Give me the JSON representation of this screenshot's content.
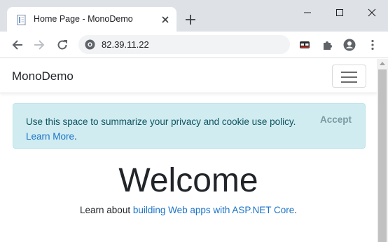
{
  "browser": {
    "tab": {
      "title": "Home Page - MonoDemo"
    },
    "address": {
      "url": "82.39.11.22"
    },
    "colors": {
      "tabstrip": "#dee1e6",
      "omnibox": "#f1f3f4"
    }
  },
  "page": {
    "brand": "MonoDemo",
    "cookie": {
      "text": "Use this space to summarize your privacy and cookie use policy.",
      "link": "Learn More",
      "after_link": ".",
      "accept": "Accept"
    },
    "heading": "Welcome",
    "learn": {
      "prefix": "Learn about ",
      "link": "building Web apps with ASP.NET Core",
      "suffix": "."
    },
    "colors": {
      "alert_bg": "#d1ecf1",
      "alert_text": "#0c5460",
      "link": "#1a73c8"
    }
  }
}
